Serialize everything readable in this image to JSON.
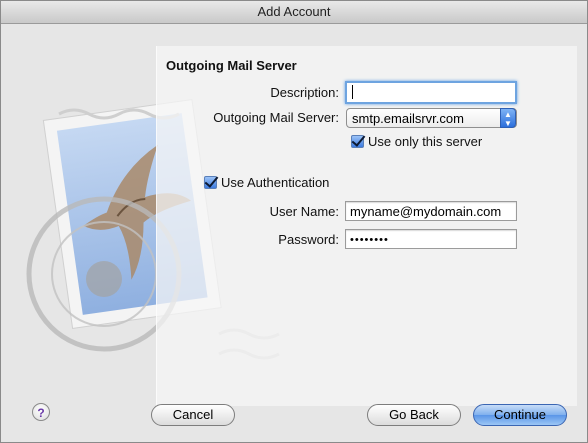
{
  "window": {
    "title": "Add Account"
  },
  "form": {
    "section_title": "Outgoing Mail Server",
    "description_label": "Description:",
    "description_value": "",
    "server_label": "Outgoing Mail Server:",
    "server_value": "smtp.emailsrvr.com",
    "use_only_label": "Use only this server",
    "use_only_checked": true,
    "use_auth_label": "Use Authentication",
    "use_auth_checked": true,
    "username_label": "User Name:",
    "username_value": "myname@mydomain.com",
    "password_label": "Password:",
    "password_value": "••••••••"
  },
  "buttons": {
    "help_label": "?",
    "cancel_label": "Cancel",
    "back_label": "Go Back",
    "continue_label": "Continue"
  },
  "colors": {
    "accent": "#5a95e8",
    "window_bg": "#e8e8e8"
  },
  "icons": {
    "stamp": "mail-stamp-icon",
    "popup_arrow": "chevron-updown-icon",
    "help": "help-icon"
  }
}
